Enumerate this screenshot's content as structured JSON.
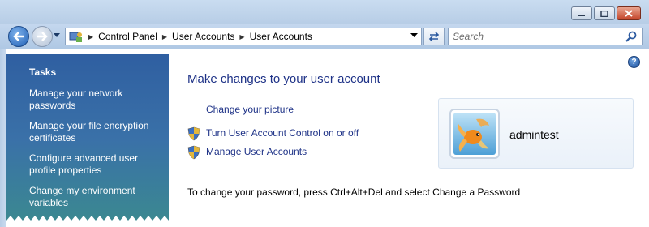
{
  "address": {
    "crumbs": [
      "Control Panel",
      "User Accounts",
      "User Accounts"
    ]
  },
  "search": {
    "placeholder": "Search"
  },
  "tasks": {
    "heading": "Tasks",
    "items": [
      "Manage your network passwords",
      "Manage your file encryption certificates",
      "Configure advanced user profile properties",
      "Change my environment variables"
    ]
  },
  "main": {
    "heading": "Make changes to your user account",
    "links": [
      "Change your picture",
      "Turn User Account Control on or off",
      "Manage User Accounts"
    ],
    "password_note": "To change your password, press Ctrl+Alt+Del and select Change a Password"
  },
  "user": {
    "name": "admintest"
  },
  "help": {
    "glyph": "?"
  },
  "icons": {
    "back": "back-arrow-icon",
    "forward": "forward-arrow-icon",
    "refresh": "refresh-icon",
    "search": "magnifier-icon",
    "shield": "uac-shield-icon",
    "control_panel": "control-panel-icon"
  },
  "colors": {
    "link": "#1e3287",
    "tasks_bg": "#3a71a8"
  }
}
